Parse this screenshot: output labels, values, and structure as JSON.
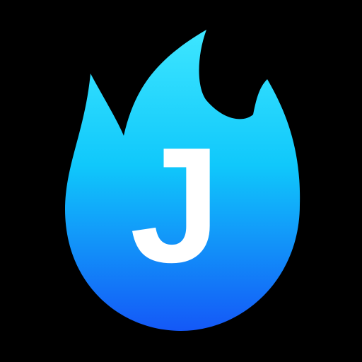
{
  "app_icon": {
    "name": "flame-j-app-icon",
    "background_color": "#000000",
    "flame_gradient": {
      "top_color": "#3ee6ff",
      "mid_color": "#10c8fb",
      "bottom_color": "#1458f7"
    },
    "letter": "J",
    "letter_color": "#ffffff"
  }
}
